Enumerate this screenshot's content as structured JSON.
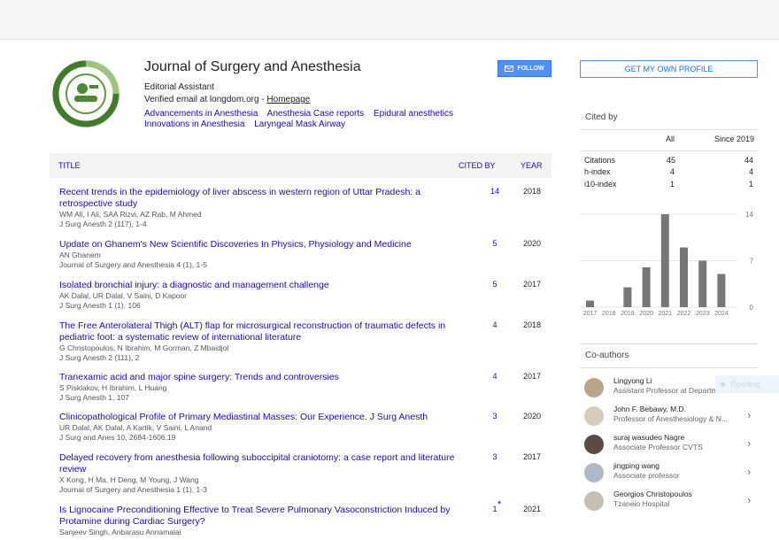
{
  "profile": {
    "name": "Journal of Surgery and Anesthesia",
    "affiliation": "Editorial Assistant",
    "verified_prefix": "Verified email at longdom.org - ",
    "homepage": "Homepage",
    "interests": [
      "Advancements in Anesthesia",
      "Anesthesia Case reports",
      "Epidural anesthetics",
      "Innovations in Anesthesia",
      "Laryngeal Mask Airway"
    ],
    "follow": "FOLLOW"
  },
  "table": {
    "col_title": "TITLE",
    "col_cited": "CITED BY",
    "col_year": "YEAR",
    "rows": [
      {
        "title": "Recent trends in the epidemiology of liver abscess in western region of Uttar Pradesh: a retrospective study",
        "authors": "WM Ali, I Ali, SAA Rizvi, AZ Rab, M Ahmed",
        "venue": "J Surg Anesth 2 (117), 1-4",
        "cited": "14",
        "year": "2018"
      },
      {
        "title": "Update on Ghanem's New Scientific Discoveries In Physics, Physiology and Medicine",
        "authors": "AN Ghanem",
        "venue": "Journal of Surgery and Anesthesia 4 (1), 1-5",
        "cited": "5",
        "year": "2020"
      },
      {
        "title": "Isolated bronchial injury: a diagnostic and management challenge",
        "authors": "AK Dalal, UR Dalal, V Saini, D Kapoor",
        "venue": "J Surg Anesth 1 (1), 106",
        "cited": "5",
        "year": "2017"
      },
      {
        "title": "The Free Anterolateral Thigh (ALT) flap for microsurgical reconstruction of traumatic defects in pediatric foot: a systematic review of international literature",
        "authors": "G Christopoulos, N Ibrahim, M Gorman, Z Mbaidjol",
        "venue": "J Surg Anesth 2 (111), 2",
        "cited": "4",
        "year": "2018"
      },
      {
        "title": "Tranexamic acid and major spine surgery: Trends and controversies",
        "authors": "S Pisklakov, H Ibrahim, L Huang",
        "venue": "J Surg Anesth 1, 107",
        "cited": "4",
        "year": "2017"
      },
      {
        "title": "Clinicopathological Profile of Primary Mediastinal Masses: Our Experience. J Surg Anesth",
        "authors": "UR Dalal, AK Dalal, A Kartik, V Saini, L Anand",
        "venue": "J Surg and Anes 10, 2684-1606.19",
        "cited": "3",
        "year": "2020"
      },
      {
        "title": "Delayed recovery from anesthesia following suboccipital craniotomy: a case report and literature review",
        "authors": "X Kong, H Ma, H Deng, M Young, J Wang",
        "venue": "Journal of Surgery and Anesthesia 1 (1), 1-3",
        "cited": "3",
        "year": "2017"
      },
      {
        "title": "Is Lignocaine Preconditioning Effective to Treat Severe Pulmonary Vasoconstriction Induced by Protamine during Cardiac Surgery?",
        "authors": "Sanjeev Singh, Anbarasu Annamalai",
        "venue": "",
        "cited": "1",
        "year": "2021",
        "star": "*"
      }
    ]
  },
  "sidebar": {
    "profile_button": "GET MY OWN PROFILE",
    "cited_by": "Cited by",
    "col_all": "All",
    "col_since": "Since 2019",
    "metrics": [
      {
        "label": "Citations",
        "all": "45",
        "since": "44"
      },
      {
        "label": "h-index",
        "all": "4",
        "since": "4"
      },
      {
        "label": "i10-index",
        "all": "1",
        "since": "1"
      }
    ],
    "coauthors_title": "Co-authors",
    "coauthors": [
      {
        "name": "Lingyong Li",
        "affiliation": "Assistant Professor at Departme..."
      },
      {
        "name": "John F. Bebawy, M.D.",
        "affiliation": "Professor of Anesthesiology & N..."
      },
      {
        "name": "suraj wasudeo Nagre",
        "affiliation": "Associate Professor CVTS"
      },
      {
        "name": "jingping wang",
        "affiliation": "Associate professor"
      },
      {
        "name": "Georgios Christopoulos",
        "affiliation": "Tzaneio Hospital"
      }
    ],
    "tooltip": "Rectang"
  },
  "chart_data": {
    "type": "bar",
    "categories": [
      "2017",
      "2018",
      "2019",
      "2020",
      "2021",
      "2022",
      "2023",
      "2024"
    ],
    "values": [
      1,
      0,
      3,
      6,
      14,
      9,
      7,
      5
    ],
    "yticks": [
      "14",
      "7",
      "0"
    ],
    "ylim": [
      0,
      14
    ],
    "color": "#777777"
  }
}
